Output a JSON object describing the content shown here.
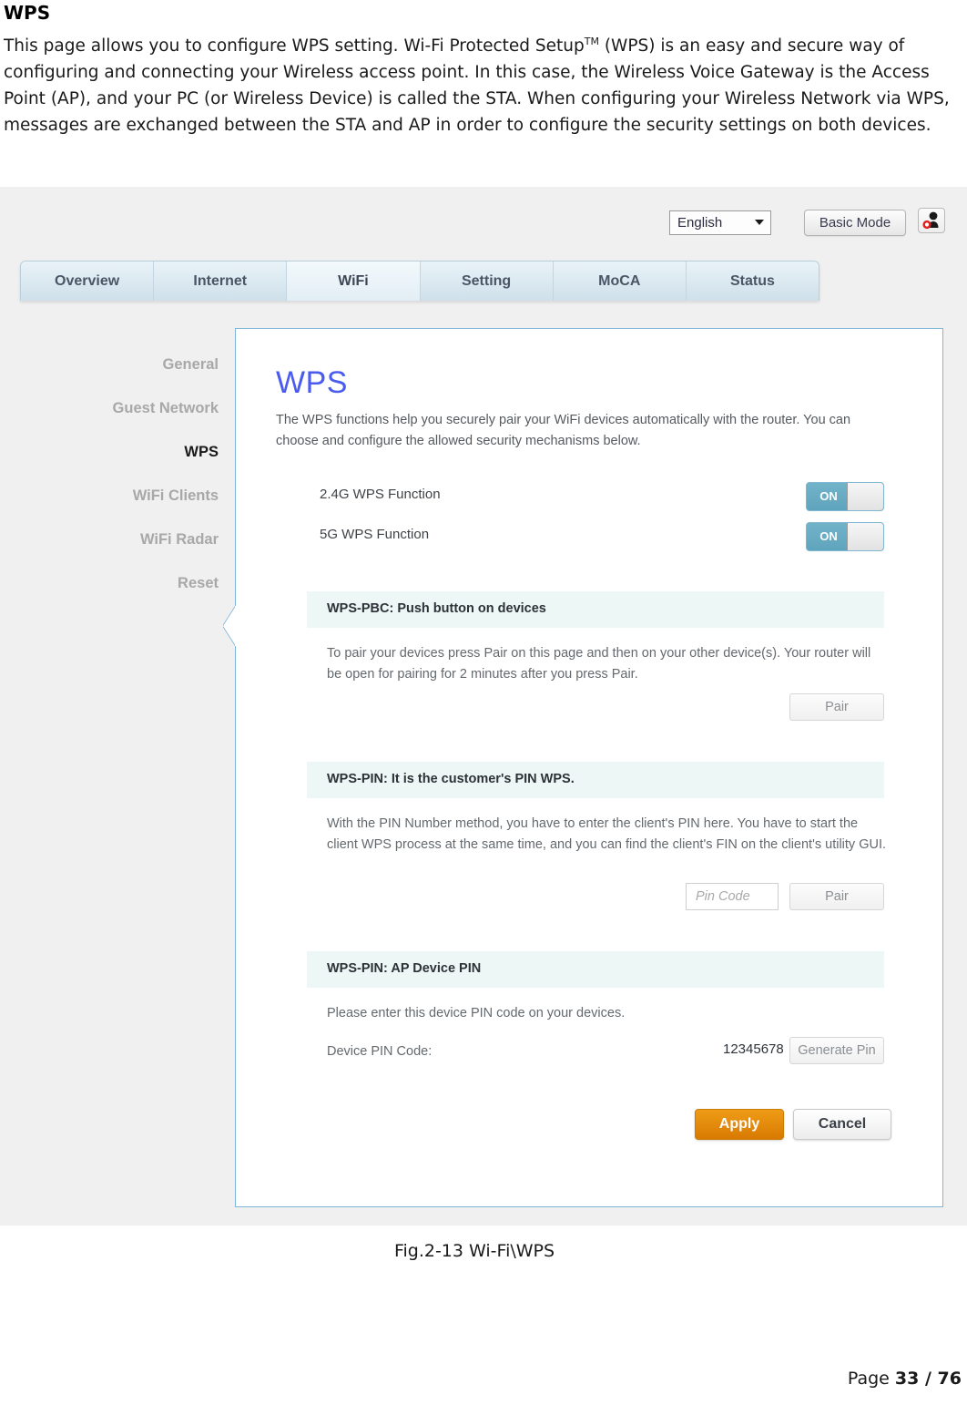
{
  "document": {
    "heading": "WPS",
    "paragraph_parts": {
      "before_tm": "This page allows you to configure WPS setting. Wi-Fi Protected Setup",
      "tm": "TM",
      "after_tm": " (WPS) is an easy and secure  way of configuring and connecting your Wireless access point. In this case, the Wireless Voice Gateway  is the Access Point (AP), and your PC (or Wireless Device) is called the STA. When configuring your  Wireless Network via WPS, messages are exchanged between the STA and AP in order to configure the  security settings on both devices."
    },
    "figure_caption": "Fig.2-13 Wi-Fi\\WPS",
    "footer": {
      "label": "Page ",
      "page": "33",
      "separator": " / ",
      "total": "76"
    }
  },
  "screenshot": {
    "topbar": {
      "language_value": "English",
      "language_options": [
        "English"
      ],
      "basic_mode_label": "Basic Mode",
      "user_icon": "user-account-icon"
    },
    "tabs": [
      {
        "label": "Overview",
        "active": false
      },
      {
        "label": "Internet",
        "active": false
      },
      {
        "label": "WiFi",
        "active": true
      },
      {
        "label": "Setting",
        "active": false
      },
      {
        "label": "MoCA",
        "active": false
      },
      {
        "label": "Status",
        "active": false
      }
    ],
    "sidebar": {
      "items": [
        {
          "label": "General",
          "active": false
        },
        {
          "label": "Guest Network",
          "active": false
        },
        {
          "label": "WPS",
          "active": true
        },
        {
          "label": "WiFi Clients",
          "active": false
        },
        {
          "label": "WiFi Radar",
          "active": false
        },
        {
          "label": "Reset",
          "active": false
        }
      ]
    },
    "panel": {
      "title": "WPS",
      "description": "The WPS functions help you securely pair your WiFi devices automatically with the router. You can choose and configure the allowed security mechanisms below.",
      "functions": [
        {
          "label": "2.4G WPS Function",
          "state": "ON"
        },
        {
          "label": "5G WPS Function",
          "state": "ON"
        }
      ],
      "sections": [
        {
          "header": "WPS-PBC: Push button on devices",
          "body": "To pair your devices press Pair on this page and then on your other device(s). Your router will be open for pairing for 2 minutes after you press Pair.",
          "pair_button": "Pair"
        },
        {
          "header": "WPS-PIN: It is the customer's PIN WPS.",
          "body": "With the PIN Number method, you have to enter the client's PIN here. You have to start the client WPS process at the same time, and you can find the client's FIN on the client's utility GUI.",
          "pin_placeholder": "Pin Code",
          "pin_value": "",
          "pair_button": "Pair"
        },
        {
          "header": "WPS-PIN: AP Device PIN",
          "body": "Please enter this device PIN code on your devices.",
          "pin_label": "Device PIN Code:",
          "pin_code": "12345678",
          "generate_button": "Generate Pin"
        }
      ],
      "actions": {
        "apply_label": "Apply",
        "cancel_label": "Cancel"
      }
    },
    "colors": {
      "accent_blue": "#4a5bf0",
      "panel_border": "#7eb6d9",
      "toggle_on": "#5fa4bd",
      "apply_orange": "#d87a01",
      "section_header_bg": "#edf7f6",
      "page_bg": "#f0f0f0"
    }
  }
}
